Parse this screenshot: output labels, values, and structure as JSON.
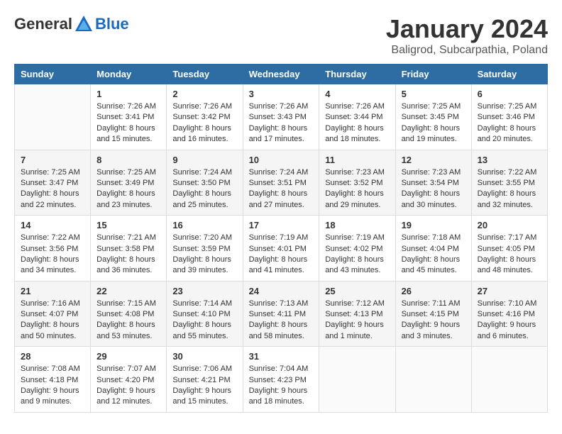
{
  "header": {
    "logo_general": "General",
    "logo_blue": "Blue",
    "title": "January 2024",
    "subtitle": "Baligrod, Subcarpathia, Poland"
  },
  "days_of_week": [
    "Sunday",
    "Monday",
    "Tuesday",
    "Wednesday",
    "Thursday",
    "Friday",
    "Saturday"
  ],
  "weeks": [
    [
      {
        "num": "",
        "info": ""
      },
      {
        "num": "1",
        "info": "Sunrise: 7:26 AM\nSunset: 3:41 PM\nDaylight: 8 hours\nand 15 minutes."
      },
      {
        "num": "2",
        "info": "Sunrise: 7:26 AM\nSunset: 3:42 PM\nDaylight: 8 hours\nand 16 minutes."
      },
      {
        "num": "3",
        "info": "Sunrise: 7:26 AM\nSunset: 3:43 PM\nDaylight: 8 hours\nand 17 minutes."
      },
      {
        "num": "4",
        "info": "Sunrise: 7:26 AM\nSunset: 3:44 PM\nDaylight: 8 hours\nand 18 minutes."
      },
      {
        "num": "5",
        "info": "Sunrise: 7:25 AM\nSunset: 3:45 PM\nDaylight: 8 hours\nand 19 minutes."
      },
      {
        "num": "6",
        "info": "Sunrise: 7:25 AM\nSunset: 3:46 PM\nDaylight: 8 hours\nand 20 minutes."
      }
    ],
    [
      {
        "num": "7",
        "info": "Sunrise: 7:25 AM\nSunset: 3:47 PM\nDaylight: 8 hours\nand 22 minutes."
      },
      {
        "num": "8",
        "info": "Sunrise: 7:25 AM\nSunset: 3:49 PM\nDaylight: 8 hours\nand 23 minutes."
      },
      {
        "num": "9",
        "info": "Sunrise: 7:24 AM\nSunset: 3:50 PM\nDaylight: 8 hours\nand 25 minutes."
      },
      {
        "num": "10",
        "info": "Sunrise: 7:24 AM\nSunset: 3:51 PM\nDaylight: 8 hours\nand 27 minutes."
      },
      {
        "num": "11",
        "info": "Sunrise: 7:23 AM\nSunset: 3:52 PM\nDaylight: 8 hours\nand 29 minutes."
      },
      {
        "num": "12",
        "info": "Sunrise: 7:23 AM\nSunset: 3:54 PM\nDaylight: 8 hours\nand 30 minutes."
      },
      {
        "num": "13",
        "info": "Sunrise: 7:22 AM\nSunset: 3:55 PM\nDaylight: 8 hours\nand 32 minutes."
      }
    ],
    [
      {
        "num": "14",
        "info": "Sunrise: 7:22 AM\nSunset: 3:56 PM\nDaylight: 8 hours\nand 34 minutes."
      },
      {
        "num": "15",
        "info": "Sunrise: 7:21 AM\nSunset: 3:58 PM\nDaylight: 8 hours\nand 36 minutes."
      },
      {
        "num": "16",
        "info": "Sunrise: 7:20 AM\nSunset: 3:59 PM\nDaylight: 8 hours\nand 39 minutes."
      },
      {
        "num": "17",
        "info": "Sunrise: 7:19 AM\nSunset: 4:01 PM\nDaylight: 8 hours\nand 41 minutes."
      },
      {
        "num": "18",
        "info": "Sunrise: 7:19 AM\nSunset: 4:02 PM\nDaylight: 8 hours\nand 43 minutes."
      },
      {
        "num": "19",
        "info": "Sunrise: 7:18 AM\nSunset: 4:04 PM\nDaylight: 8 hours\nand 45 minutes."
      },
      {
        "num": "20",
        "info": "Sunrise: 7:17 AM\nSunset: 4:05 PM\nDaylight: 8 hours\nand 48 minutes."
      }
    ],
    [
      {
        "num": "21",
        "info": "Sunrise: 7:16 AM\nSunset: 4:07 PM\nDaylight: 8 hours\nand 50 minutes."
      },
      {
        "num": "22",
        "info": "Sunrise: 7:15 AM\nSunset: 4:08 PM\nDaylight: 8 hours\nand 53 minutes."
      },
      {
        "num": "23",
        "info": "Sunrise: 7:14 AM\nSunset: 4:10 PM\nDaylight: 8 hours\nand 55 minutes."
      },
      {
        "num": "24",
        "info": "Sunrise: 7:13 AM\nSunset: 4:11 PM\nDaylight: 8 hours\nand 58 minutes."
      },
      {
        "num": "25",
        "info": "Sunrise: 7:12 AM\nSunset: 4:13 PM\nDaylight: 9 hours\nand 1 minute."
      },
      {
        "num": "26",
        "info": "Sunrise: 7:11 AM\nSunset: 4:15 PM\nDaylight: 9 hours\nand 3 minutes."
      },
      {
        "num": "27",
        "info": "Sunrise: 7:10 AM\nSunset: 4:16 PM\nDaylight: 9 hours\nand 6 minutes."
      }
    ],
    [
      {
        "num": "28",
        "info": "Sunrise: 7:08 AM\nSunset: 4:18 PM\nDaylight: 9 hours\nand 9 minutes."
      },
      {
        "num": "29",
        "info": "Sunrise: 7:07 AM\nSunset: 4:20 PM\nDaylight: 9 hours\nand 12 minutes."
      },
      {
        "num": "30",
        "info": "Sunrise: 7:06 AM\nSunset: 4:21 PM\nDaylight: 9 hours\nand 15 minutes."
      },
      {
        "num": "31",
        "info": "Sunrise: 7:04 AM\nSunset: 4:23 PM\nDaylight: 9 hours\nand 18 minutes."
      },
      {
        "num": "",
        "info": ""
      },
      {
        "num": "",
        "info": ""
      },
      {
        "num": "",
        "info": ""
      }
    ]
  ]
}
